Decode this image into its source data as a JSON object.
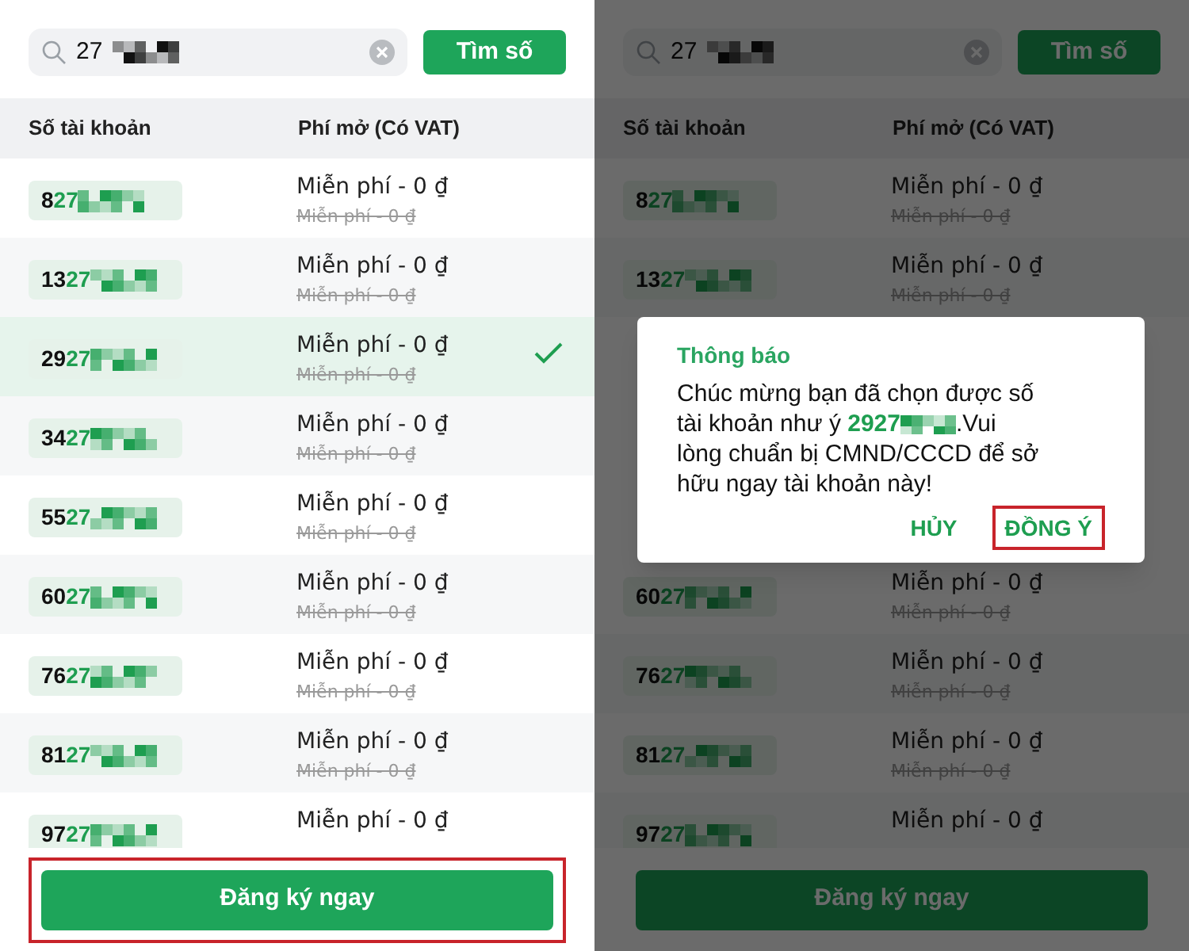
{
  "left_screen": {
    "search": {
      "value": "27"
    },
    "search_button": "Tìm số",
    "columns": [
      "Số tài khoản",
      "Phí mở (Có VAT)"
    ],
    "rows": [
      {
        "prefix": "8",
        "match": "27",
        "fee": "Miễn phí - 0 ₫",
        "old_fee": "Miễn phí - 0 ₫",
        "selected": false
      },
      {
        "prefix": "13",
        "match": "27",
        "fee": "Miễn phí - 0 ₫",
        "old_fee": "Miễn phí - 0 ₫",
        "selected": false
      },
      {
        "prefix": "29",
        "match": "27",
        "fee": "Miễn phí - 0 ₫",
        "old_fee": "Miễn phí - 0 ₫",
        "selected": true
      },
      {
        "prefix": "34",
        "match": "27",
        "fee": "Miễn phí - 0 ₫",
        "old_fee": "Miễn phí - 0 ₫",
        "selected": false
      },
      {
        "prefix": "55",
        "match": "27",
        "fee": "Miễn phí - 0 ₫",
        "old_fee": "Miễn phí - 0 ₫",
        "selected": false
      },
      {
        "prefix": "60",
        "match": "27",
        "fee": "Miễn phí - 0 ₫",
        "old_fee": "Miễn phí - 0 ₫",
        "selected": false
      },
      {
        "prefix": "76",
        "match": "27",
        "fee": "Miễn phí - 0 ₫",
        "old_fee": "Miễn phí - 0 ₫",
        "selected": false
      },
      {
        "prefix": "81",
        "match": "27",
        "fee": "Miễn phí - 0 ₫",
        "old_fee": "Miễn phí - 0 ₫",
        "selected": false
      },
      {
        "prefix": "97",
        "match": "27",
        "fee": "Miễn phí - 0 ₫",
        "selected": false
      }
    ],
    "register_button": {
      "label": "Đăng ký ngay",
      "highlighted": true
    }
  },
  "right_screen": {
    "search": {
      "value": "27"
    },
    "search_button": "Tìm số",
    "columns": [
      "Số tài khoản",
      "Phí mở (Có VAT)"
    ],
    "rows_above": [
      {
        "prefix": "8",
        "match": "27",
        "fee": "Miễn phí - 0 ₫",
        "old_fee": "Miễn phí - 0 ₫",
        "selected": false
      },
      {
        "prefix": "13",
        "match": "27",
        "fee": "Miễn phí - 0 ₫",
        "old_fee": "Miễn phí - 0 ₫",
        "selected": false
      }
    ],
    "rows_below": [
      {
        "prefix": "60",
        "match": "27",
        "fee": "Miễn phí - 0 ₫",
        "old_fee": "Miễn phí - 0 ₫",
        "selected": false
      },
      {
        "prefix": "76",
        "match": "27",
        "fee": "Miễn phí - 0 ₫",
        "old_fee": "Miễn phí - 0 ₫",
        "selected": false
      },
      {
        "prefix": "81",
        "match": "27",
        "fee": "Miễn phí - 0 ₫",
        "old_fee": "Miễn phí - 0 ₫",
        "selected": false
      },
      {
        "prefix": "97",
        "match": "27",
        "fee": "Miễn phí - 0 ₫",
        "selected": false
      }
    ],
    "register_button": {
      "label": "Đăng ký ngay",
      "highlighted": false
    },
    "dialog": {
      "title": "Thông báo",
      "message_first_line": "Chúc mừng bạn đã chọn được số",
      "message_before": "tài khoản như ý",
      "number": "2927",
      "message_after": ".Vui",
      "message_rest": "lòng chuẩn bị CMND/CCCD để sở hữu ngay tài khoản này!",
      "buttons": [
        {
          "label": "HỦY",
          "highlighted": false
        },
        {
          "label": "ĐỒNG Ý",
          "highlighted": true
        }
      ]
    }
  }
}
